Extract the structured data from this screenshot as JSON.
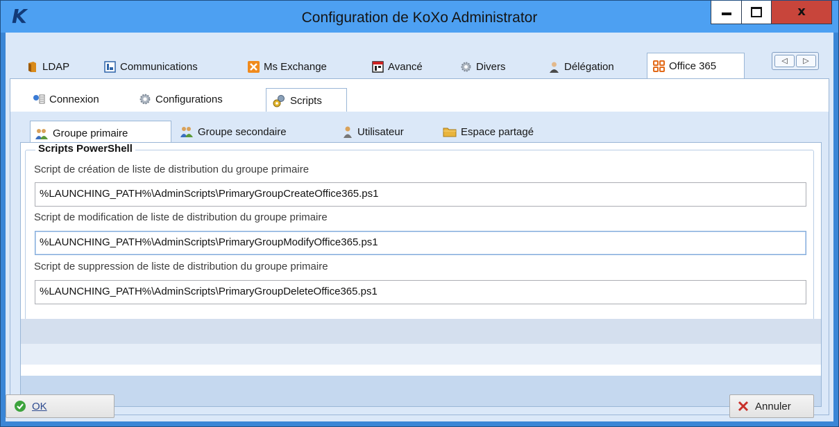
{
  "window": {
    "title": "Configuration de KoXo Administrator",
    "logo_letter": "K",
    "close_glyph": "x"
  },
  "main_tabs": [
    {
      "label": "LDAP",
      "icon": "book-icon"
    },
    {
      "label": "Communications",
      "icon": "communications-icon"
    },
    {
      "label": "Ms Exchange",
      "icon": "exchange-icon"
    },
    {
      "label": "Avancé",
      "icon": "advanced-icon"
    },
    {
      "label": "Divers",
      "icon": "gear-icon"
    },
    {
      "label": "Délégation",
      "icon": "user-icon"
    },
    {
      "label": "Office 365",
      "icon": "office365-icon",
      "active": true
    }
  ],
  "sub_tabs": [
    {
      "label": "Connexion",
      "icon": "connection-icon"
    },
    {
      "label": "Configurations",
      "icon": "gear-icon"
    },
    {
      "label": "Scripts",
      "icon": "scripts-icon",
      "active": true
    }
  ],
  "inner_tabs": [
    {
      "label": "Groupe primaire",
      "icon": "group-icon",
      "active": true
    },
    {
      "label": "Groupe secondaire",
      "icon": "group-icon"
    },
    {
      "label": "Utilisateur",
      "icon": "user-icon"
    },
    {
      "label": "Espace partagé",
      "icon": "folder-icon"
    }
  ],
  "scripts": {
    "group_title": "Scripts PowerShell",
    "fields": [
      {
        "label": "Script de création de liste de distribution du groupe primaire",
        "value": "%LAUNCHING_PATH%\\AdminScripts\\PrimaryGroupCreateOffice365.ps1"
      },
      {
        "label": "Script de modification de liste de distribution du groupe primaire",
        "value": "%LAUNCHING_PATH%\\AdminScripts\\PrimaryGroupModifyOffice365.ps1"
      },
      {
        "label": "Script de suppression de liste de distribution du groupe primaire",
        "value": "%LAUNCHING_PATH%\\AdminScripts\\PrimaryGroupDeleteOffice365.ps1"
      }
    ]
  },
  "buttons": {
    "ok_label": "OK",
    "cancel_label": "Annuler"
  },
  "colors": {
    "title_bar": "#4da0f2",
    "close_button": "#c8453b",
    "tab_background": "#dbe8f8",
    "ok_check": "#3da33d",
    "cancel_x": "#c8302a"
  }
}
